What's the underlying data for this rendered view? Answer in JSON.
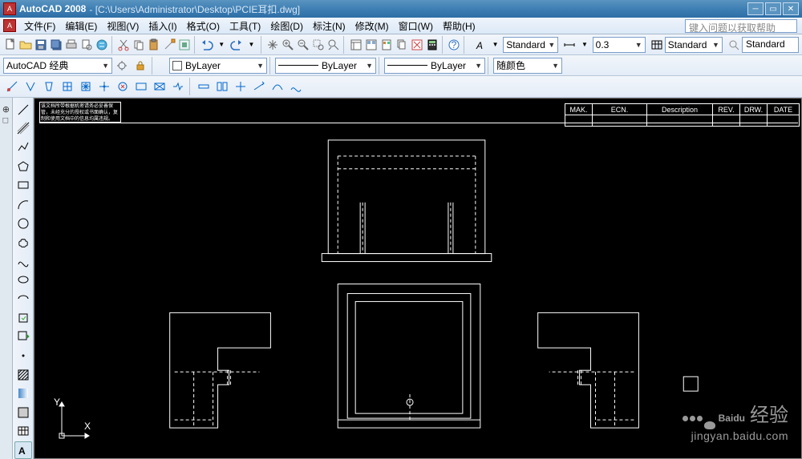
{
  "title": {
    "app": "AutoCAD 2008",
    "path": "- [C:\\Users\\Administrator\\Desktop\\PCIE耳扣.dwg]"
  },
  "menu": {
    "file": "文件(F)",
    "edit": "编辑(E)",
    "view": "视图(V)",
    "insert": "插入(I)",
    "format": "格式(O)",
    "tools": "工具(T)",
    "draw": "绘图(D)",
    "dimension": "标注(N)",
    "modify": "修改(M)",
    "window": "窗口(W)",
    "help": "帮助(H)",
    "helpbox": "键入问题以获取帮助"
  },
  "workspace": "AutoCAD 经典",
  "layer": {
    "name": "ByLayer"
  },
  "linetype": {
    "label": "ByLayer"
  },
  "lineweight": {
    "label": "ByLayer"
  },
  "color": {
    "label": "随颜色"
  },
  "textstyle": "Standard",
  "dimstyle": "0.3",
  "tablestyle": "Standard",
  "tablestyle2": "Standard",
  "drawing_table": {
    "headers": [
      "MAK.",
      "ECN.",
      "Description",
      "REV.",
      "DRW.",
      "DATE"
    ]
  },
  "note": "该文档所带根据机密请务必妥善保管，未经充分的授权或书面确认，复制和使用文档中的信息均属违规。",
  "watermark": {
    "brand": "Bai",
    "du": "du",
    "cn": "经验",
    "url": "jingyan.baidu.com"
  },
  "ucs": {
    "x": "X",
    "y": "Y"
  }
}
